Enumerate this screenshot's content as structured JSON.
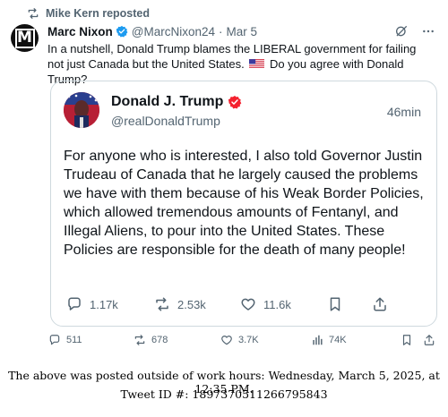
{
  "repost": {
    "label": "Mike Kern reposted"
  },
  "tweet": {
    "author_name": "Marc Nixon",
    "handle": "@MarcNixon24",
    "separator": "·",
    "date": "Mar 5",
    "text_before_flag": "In a nutshell, Donald Trump blames the LIBERAL government for failing not just Canada but the United States.",
    "text_after_flag": "Do you agree with Donald Trump?",
    "avatar_letter": "M"
  },
  "quote": {
    "author_name": "Donald J. Trump",
    "handle": "@realDonaldTrump",
    "time": "46min",
    "text": "For anyone who is interested, I also told Governor Justin Trudeau of Canada that he largely caused the problems we have with them because of his Weak Border Policies, which allowed tremendous amounts of Fentanyl, and Illegal Aliens, to pour into the United States. These Policies are responsible for the death of many people!",
    "replies": "1.17k",
    "reposts": "2.53k",
    "likes": "11.6k"
  },
  "actions": {
    "replies": "511",
    "reposts": "678",
    "likes": "3.7K",
    "views": "74K"
  },
  "footer": {
    "line1": "The above was posted outside of work hours: Wednesday, March 5, 2025, at 12:35 PM.",
    "line2": "Tweet ID #: 1897370511266795843"
  },
  "colors": {
    "verified_blue": "#1d9bf0",
    "trump_verified": "#f4212e",
    "secondary_text": "#536471",
    "border": "#cfd9de"
  },
  "icons": [
    "repost-icon",
    "verified-icon",
    "grok-icon",
    "more-icon",
    "reply-icon",
    "like-icon",
    "bookmark-icon",
    "share-icon",
    "views-icon",
    "us-flag-icon"
  ]
}
